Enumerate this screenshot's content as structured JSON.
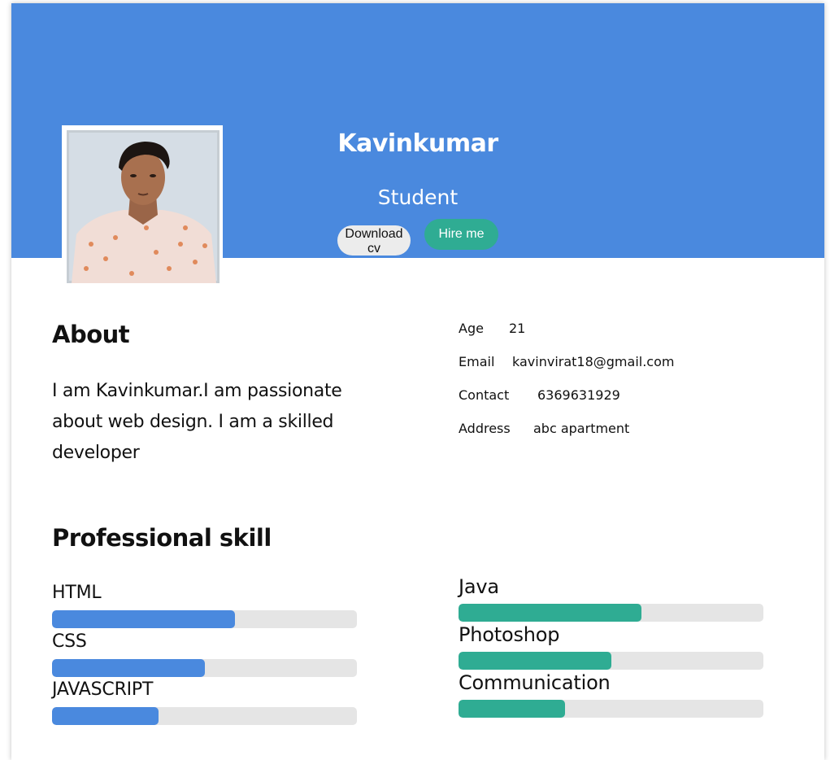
{
  "profile": {
    "name": "Kavinkumar",
    "role": "Student",
    "download_label": "Download cv",
    "hire_label": "Hire me"
  },
  "about": {
    "heading": "About",
    "text": "I am Kavinkumar.I am passionate about web design. I am a skilled developer"
  },
  "info": [
    {
      "label": "Age",
      "value": "21"
    },
    {
      "label": "Email",
      "value": "kavinvirat18@gmail.com"
    },
    {
      "label": "Contact",
      "value": "6369631929"
    },
    {
      "label": "Address",
      "value": "abc apartment"
    }
  ],
  "skills": {
    "heading": "Professional skill",
    "left": [
      {
        "label": "HTML",
        "level": 0.6
      },
      {
        "label": "CSS",
        "level": 0.5
      },
      {
        "label": "JAVASCRIPT",
        "level": 0.35
      }
    ],
    "right": [
      {
        "label": "Java",
        "level": 0.6
      },
      {
        "label": "Photoshop",
        "level": 0.5
      },
      {
        "label": "Communication",
        "level": 0.35
      }
    ]
  },
  "colors": {
    "banner": "#4a89de",
    "accent": "#2fac93",
    "track": "#e5e5e5"
  },
  "icons": {
    "avatar": "person-photo"
  }
}
